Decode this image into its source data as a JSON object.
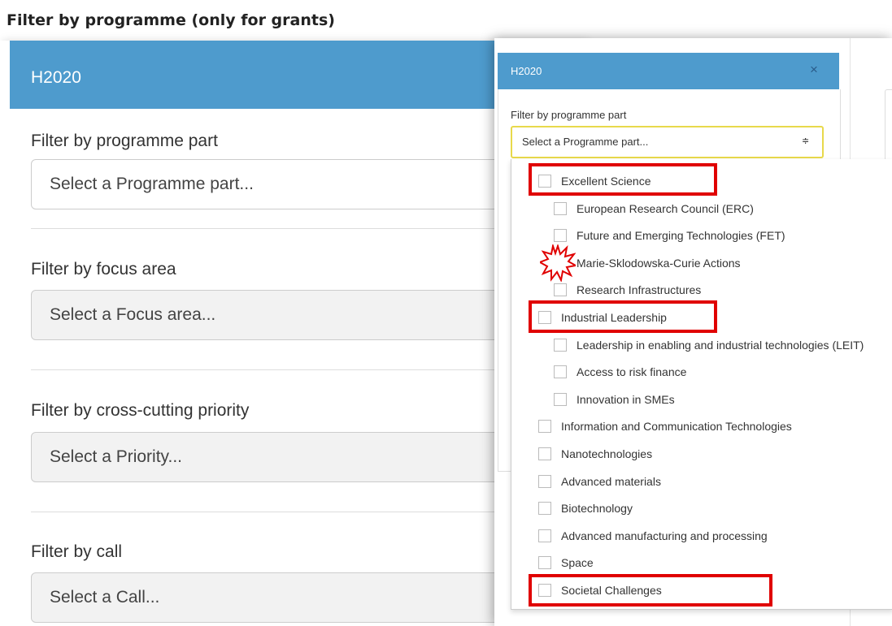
{
  "background": {
    "title": "Filter by programme (only for grants)",
    "header_title": "H2020",
    "filters": [
      {
        "label": "Filter by programme part",
        "placeholder": "Select a Programme part..."
      },
      {
        "label": "Filter by focus area",
        "placeholder": "Select a Focus area..."
      },
      {
        "label": "Filter by cross-cutting priority",
        "placeholder": "Select a Priority..."
      },
      {
        "label": "Filter by call",
        "placeholder": "Select a Call..."
      }
    ]
  },
  "modal": {
    "header_title": "H2020",
    "close_symbol": "×",
    "filter_label": "Filter by programme part",
    "select_placeholder": "Select a Programme part...",
    "select_arrow": "≑",
    "options": [
      {
        "label": "Excellent Science",
        "level": 0,
        "highlighted": true
      },
      {
        "label": "European Research Council (ERC)",
        "level": 1
      },
      {
        "label": "Future and Emerging Technologies (FET)",
        "level": 1
      },
      {
        "label": "Marie-Sklodowska-Curie Actions",
        "level": 1,
        "burst": true
      },
      {
        "label": "Research Infrastructures",
        "level": 1
      },
      {
        "label": "Industrial Leadership",
        "level": 0,
        "highlighted": true
      },
      {
        "label": "Leadership in enabling and industrial technologies (LEIT)",
        "level": 1
      },
      {
        "label": "Access to risk finance",
        "level": 1
      },
      {
        "label": "Innovation in SMEs",
        "level": 1
      },
      {
        "label": "Information and Communication Technologies",
        "level": 0
      },
      {
        "label": "Nanotechnologies",
        "level": 0
      },
      {
        "label": "Advanced materials",
        "level": 0
      },
      {
        "label": "Biotechnology",
        "level": 0
      },
      {
        "label": "Advanced manufacturing and processing",
        "level": 0
      },
      {
        "label": "Space",
        "level": 0
      },
      {
        "label": "Societal Challenges",
        "level": 0,
        "highlighted": true
      }
    ]
  },
  "colors": {
    "header_blue": "#4e9bcd",
    "highlight_red": "#e00000",
    "select_focus_border": "#e8d94b"
  }
}
